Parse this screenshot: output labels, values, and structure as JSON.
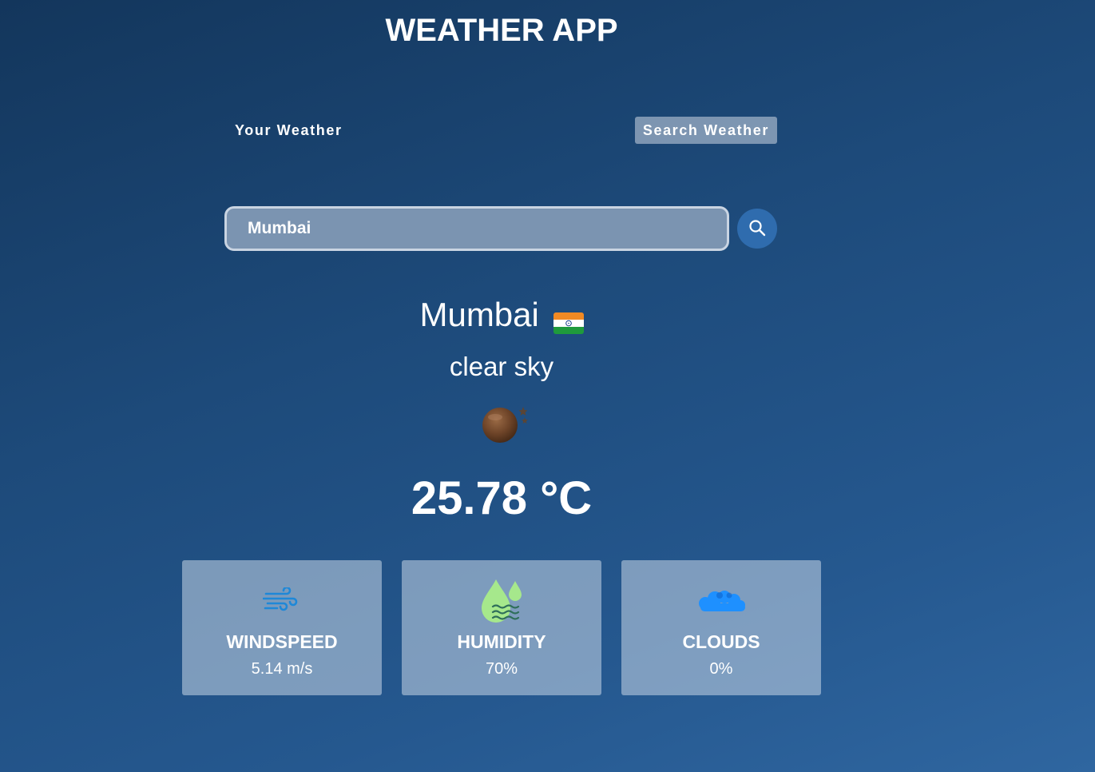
{
  "header": {
    "title": "WEATHER APP"
  },
  "tabs": [
    {
      "label": "Your Weather",
      "active": false
    },
    {
      "label": "Search Weather",
      "active": true
    }
  ],
  "search": {
    "value": "Mumbai",
    "button_icon": "search-icon"
  },
  "weather": {
    "city": "Mumbai",
    "country_flag_icon": "india-flag-icon",
    "description": "clear sky",
    "condition_icon": "clear-night-moon-icon",
    "temperature": "25.78 °C"
  },
  "stats": [
    {
      "icon": "wind-icon",
      "label": "WINDSPEED",
      "value": "5.14 m/s"
    },
    {
      "icon": "humidity-icon",
      "label": "HUMIDITY",
      "value": "70%"
    },
    {
      "icon": "clouds-icon",
      "label": "CLOUDS",
      "value": "0%"
    }
  ],
  "colors": {
    "accent_button": "#2f6cae",
    "card_background": "#8aa3c2",
    "humidity_icon": "#a6e88c",
    "clouds_icon": "#1e90ff",
    "wind_icon": "#1e88d8"
  }
}
